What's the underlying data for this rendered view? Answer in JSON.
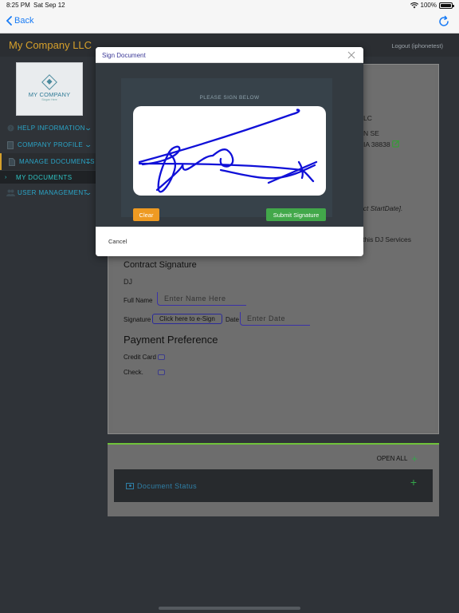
{
  "status_bar": {
    "time": "8:25 PM",
    "date": "Sat Sep 12",
    "battery": "100%"
  },
  "nav": {
    "back_label": "Back"
  },
  "header": {
    "company_name": "My Company LLC",
    "logout_label": "Logout (iphonetest)"
  },
  "logo": {
    "text": "MY COMPANY",
    "tagline": "Slogan Here"
  },
  "sidebar": {
    "items": [
      {
        "label": "HELP INFORMATION",
        "icon": "question-icon"
      },
      {
        "label": "COMPANY PROFILE",
        "icon": "document-icon"
      },
      {
        "label": "MANAGE DOCUMENTS",
        "icon": "file-icon"
      },
      {
        "label": "MY DOCUMENTS",
        "icon": "bullet-icon"
      },
      {
        "label": "USER MANAGEMENT",
        "icon": "users-icon"
      }
    ]
  },
  "document": {
    "address_line1": "LC",
    "address_line2": "N SE",
    "address_line3": "IA 38838",
    "contract_date_fragment": "act StartDate].",
    "services_fragment": "g this DJ Services",
    "contract_signature_title": "Contract Signature",
    "signer_name": "DJ",
    "full_name_label": "Full Name",
    "full_name_placeholder": "Enter Name Here",
    "signature_label": "Signature",
    "esign_label": "Click here to e-Sign",
    "date_label": "Date",
    "date_placeholder": "Enter Date",
    "payment_title": "Payment Preference",
    "credit_card_label": "Credit Card",
    "check_label": "Check."
  },
  "status_panel": {
    "open_all_label": "OPEN ALL",
    "document_status_label": "Document Status"
  },
  "modal": {
    "title": "Sign Document",
    "caption": "PLEASE SIGN BELOW",
    "clear_label": "Clear",
    "submit_label": "Submit Signature",
    "cancel_label": "Cancel"
  },
  "colors": {
    "accent_gold": "#d6a02b",
    "nav_blue": "#2aa6c9",
    "clear_orange": "#ee9a22",
    "submit_green": "#42a84a",
    "signature_blue": "#1010d8"
  }
}
